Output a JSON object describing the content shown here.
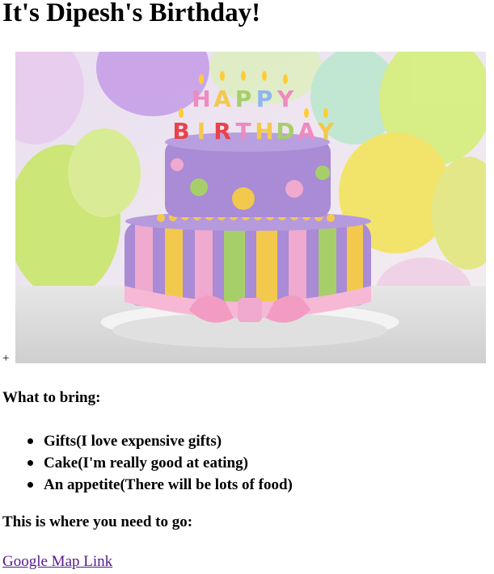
{
  "heading": "It's Dipesh's Birthday!",
  "image": {
    "prefix_text": "+",
    "candle_letters": [
      "H",
      "A",
      "P",
      "P",
      "Y",
      "B",
      "I",
      "R",
      "T",
      "H",
      "D",
      "A",
      "Y"
    ],
    "colors": {
      "balloon_green": "#c9e76a",
      "balloon_purple": "#c6a0e8",
      "balloon_yellow": "#f3e45c",
      "cake_lilac": "#a98bd6",
      "stripe_yellow": "#f2c94c",
      "stripe_green": "#a6cf6a",
      "stripe_pink": "#f0a9cf",
      "ribbon_pink": "#f6b8d4",
      "plate": "#f3f3f3"
    }
  },
  "bring": {
    "title": "What to bring:",
    "items": [
      "Gifts(I love expensive gifts)",
      "Cake(I'm really good at eating)",
      "An appetite(There will be lots of food)"
    ]
  },
  "location": {
    "title": "This is where you need to go:",
    "link_text": "Google Map Link"
  }
}
